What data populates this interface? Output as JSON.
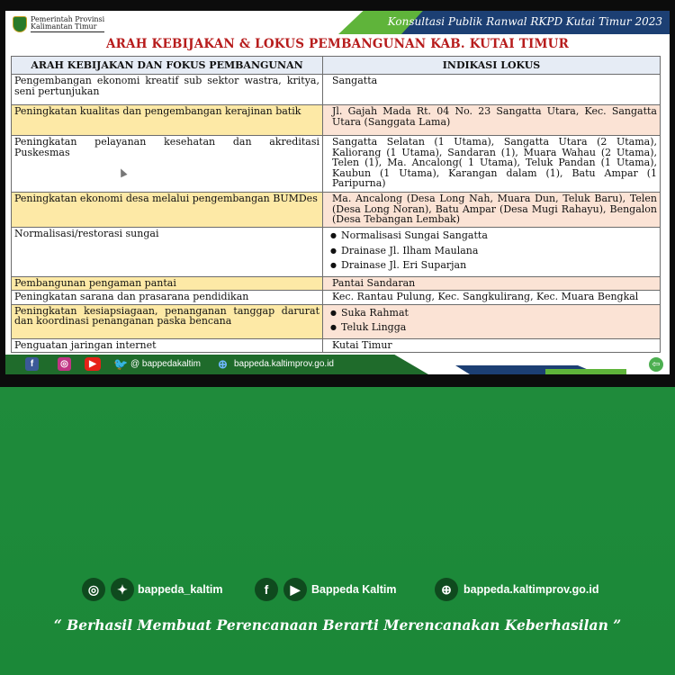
{
  "slide": {
    "header_caption": "Konsultasi  Publik Ranwal RKPD Kutai Timur  2023",
    "logo_line1": "Pemerintah Provinsi",
    "logo_line2": "Kalimantan Timur",
    "title": "ARAH KEBIJAKAN & LOKUS PEMBANGUNAN KAB. KUTAI TIMUR",
    "table": {
      "headers": [
        "ARAH KEBIJAKAN DAN FOKUS PEMBANGUNAN",
        "INDIKASI LOKUS"
      ],
      "rows": [
        {
          "policy": "Pengembangan ekonomi kreatif sub sektor wastra, kritya, seni pertunjukan",
          "locus": "Sangatta"
        },
        {
          "policy": "Peningkatan kualitas dan pengembangan kerajinan batik",
          "locus": "Jl. Gajah Mada Rt. 04 No. 23 Sangatta Utara, Kec. Sangatta Utara (Sanggata Lama)"
        },
        {
          "policy": "Peningkatan pelayanan kesehatan dan akreditasi Puskesmas",
          "locus": "Sangatta Selatan (1 Utama), Sangatta Utara (2 Utama), Kaliorang (1 Utama), Sandaran (1), Muara Wahau (2 Utama), Telen (1), Ma. Ancalong( 1 Utama), Teluk Pandan (1 Utama), Kaubun (1 Utama), Karangan dalam (1), Batu Ampar (1 Paripurna)"
        },
        {
          "policy": "Peningkatan ekonomi desa melalui pengembangan BUMDes",
          "locus": "Ma. Ancalong (Desa Long Nah, Muara Dun, Teluk Baru), Telen (Desa Long Noran), Batu Ampar (Desa Mugi Rahayu), Bengalon (Desa Tebangan Lembak)"
        },
        {
          "policy": "Normalisasi/restorasi sungai",
          "locus_list": [
            "Normalisasi Sungai Sangatta",
            "Drainase Jl. Ilham Maulana",
            "Drainase Jl. Eri Suparjan"
          ]
        },
        {
          "policy": "Pembangunan pengaman pantai",
          "locus": "Pantai Sandaran"
        },
        {
          "policy": "Peningkatan sarana dan prasarana pendidikan",
          "locus": "Kec. Rantau Pulung, Kec. Sangkulirang, Kec. Muara Bengkal"
        },
        {
          "policy": "Peningkatan kesiapsiagaan, penanganan tanggap darurat dan koordinasi penanganan paska bencana",
          "locus_list": [
            "Suka Rahmat",
            "Teluk Lingga"
          ]
        },
        {
          "policy": "Penguatan jaringan internet",
          "locus": "Kutai Timur"
        }
      ]
    },
    "footer": {
      "twitter_handle": "@ bappedakaltim",
      "website": "bappeda.kaltimprov.go.id",
      "icons": [
        "facebook-icon",
        "instagram-icon",
        "youtube-icon",
        "twitter-icon",
        "globe-icon",
        "back-arrow-icon"
      ]
    }
  },
  "card": {
    "instagram_twitter_handle": "bappeda_kaltim",
    "facebook_youtube_name": "Bappeda Kaltim",
    "website": "bappeda.kaltimprov.go.id",
    "tagline": "“ Berhasil  Membuat Perencanaan Berarti Merencanakan Keberhasilan ”",
    "icons": [
      "instagram-icon",
      "twitter-icon",
      "facebook-icon",
      "youtube-icon",
      "globe-icon"
    ]
  },
  "colors": {
    "title_red": "#b71c1c",
    "header_navy": "#1c3f73",
    "accent_green": "#5fb43a",
    "card_green": "#1f8b3b",
    "highlight_yellow": "#fde9a6",
    "highlight_peach": "#fbe3d5"
  }
}
